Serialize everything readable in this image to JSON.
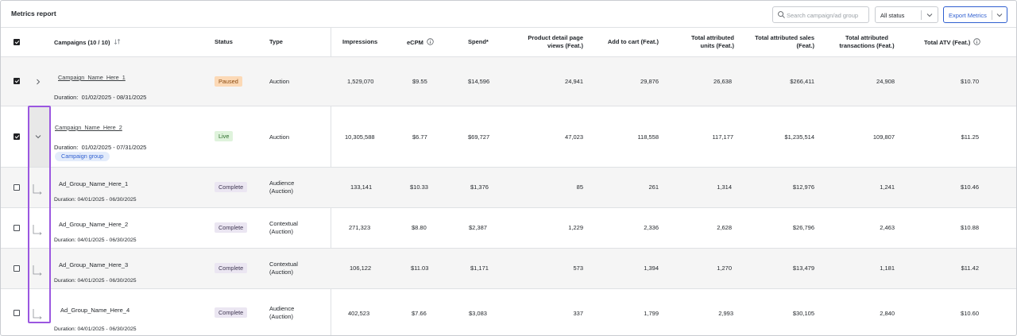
{
  "header": {
    "title": "Metrics report",
    "search_placeholder": "Search campaign/ad group",
    "status_filter": "All status",
    "export_label": "Export Metrics"
  },
  "table": {
    "columns": {
      "campaigns": "Campaigns (10 / 10)",
      "status": "Status",
      "type": "Type",
      "impressions": "Impressions",
      "ecpm": "eCPM",
      "spend": "Spend",
      "spend_mark": "*",
      "pdp_views": [
        "Product detail page",
        "views (Feat.)"
      ],
      "add_to_cart": "Add to cart (Feat.)",
      "units": [
        "Total attributed",
        "units (Feat.)"
      ],
      "sales": [
        "Total attributed sales",
        "(Feat.)"
      ],
      "transactions": [
        "Total attributed",
        "transactions (Feat.)"
      ],
      "atv": "Total ATV (Feat.)"
    },
    "duration_label": "Duration:",
    "campaign_group_label": "Campaign group",
    "rows": [
      {
        "name": "Campaign_Name_Here_1",
        "duration": "01/02/2025 - 08/31/2025",
        "status": "Paused",
        "type": [
          "Auction"
        ],
        "impressions": "1,529,070",
        "ecpm": "$9.55",
        "spend": "$14,596",
        "pdp_views": "24,941",
        "add_to_cart": "29,876",
        "units": "26,638",
        "sales": "$266,411",
        "transactions": "24,908",
        "atv": "$10.70"
      },
      {
        "name": "Campaign_Name_Here_2",
        "duration": "01/02/2025 - 07/31/2025",
        "status": "Live",
        "type": [
          "Auction"
        ],
        "impressions": "10,305,588",
        "ecpm": "$6.77",
        "spend": "$69,727",
        "pdp_views": "47,023",
        "add_to_cart": "118,558",
        "units": "117,177",
        "sales": "$1,235,514",
        "transactions": "109,807",
        "atv": "$11.25"
      },
      {
        "name": "Ad_Group_Name_Here_1",
        "duration": "04/01/2025 - 06/30/2025",
        "status": "Complete",
        "type": [
          "Audience",
          "(Auction)"
        ],
        "impressions": "133,141",
        "ecpm": "$10.33",
        "spend": "$1,376",
        "pdp_views": "85",
        "add_to_cart": "261",
        "units": "1,314",
        "sales": "$12,976",
        "transactions": "1,241",
        "atv": "$10.46"
      },
      {
        "name": "Ad_Group_Name_Here_2",
        "duration": "04/01/2025 - 06/30/2025",
        "status": "Complete",
        "type": [
          "Contextual",
          "(Auction)"
        ],
        "impressions": "271,323",
        "ecpm": "$8.80",
        "spend": "$2,387",
        "pdp_views": "1,229",
        "add_to_cart": "2,336",
        "units": "2,628",
        "sales": "$26,796",
        "transactions": "2,463",
        "atv": "$10.88"
      },
      {
        "name": "Ad_Group_Name_Here_3",
        "duration": "04/01/2025 - 06/30/2025",
        "status": "Complete",
        "type": [
          "Contextual",
          "(Auction)"
        ],
        "impressions": "106,122",
        "ecpm": "$11.03",
        "spend": "$1,171",
        "pdp_views": "573",
        "add_to_cart": "1,394",
        "units": "1,270",
        "sales": "$13,479",
        "transactions": "1,181",
        "atv": "$11.42"
      },
      {
        "name": "Ad_Group_Name_Here_4",
        "duration": "04/01/2025 - 06/30/2025",
        "status": "Complete",
        "type": [
          "Audience",
          "(Auction)"
        ],
        "impressions": "402,523",
        "ecpm": "$7.66",
        "spend": "$3,083",
        "pdp_views": "337",
        "add_to_cart": "1,799",
        "units": "2,993",
        "sales": "$30,105",
        "transactions": "2,840",
        "atv": "$10.60"
      }
    ]
  },
  "colors": {
    "accent": "#2f5fd0",
    "focus_outline": "#9b57e0",
    "paused_bg": "#fcd9b6",
    "live_bg": "#dff3dc",
    "complete_bg": "#ebe6f2"
  },
  "icons": [
    "search-icon",
    "chevron-down-icon",
    "sort-icon",
    "info-icon",
    "chevron-right-icon",
    "tree-elbow-icon",
    "checkbox-checked"
  ]
}
